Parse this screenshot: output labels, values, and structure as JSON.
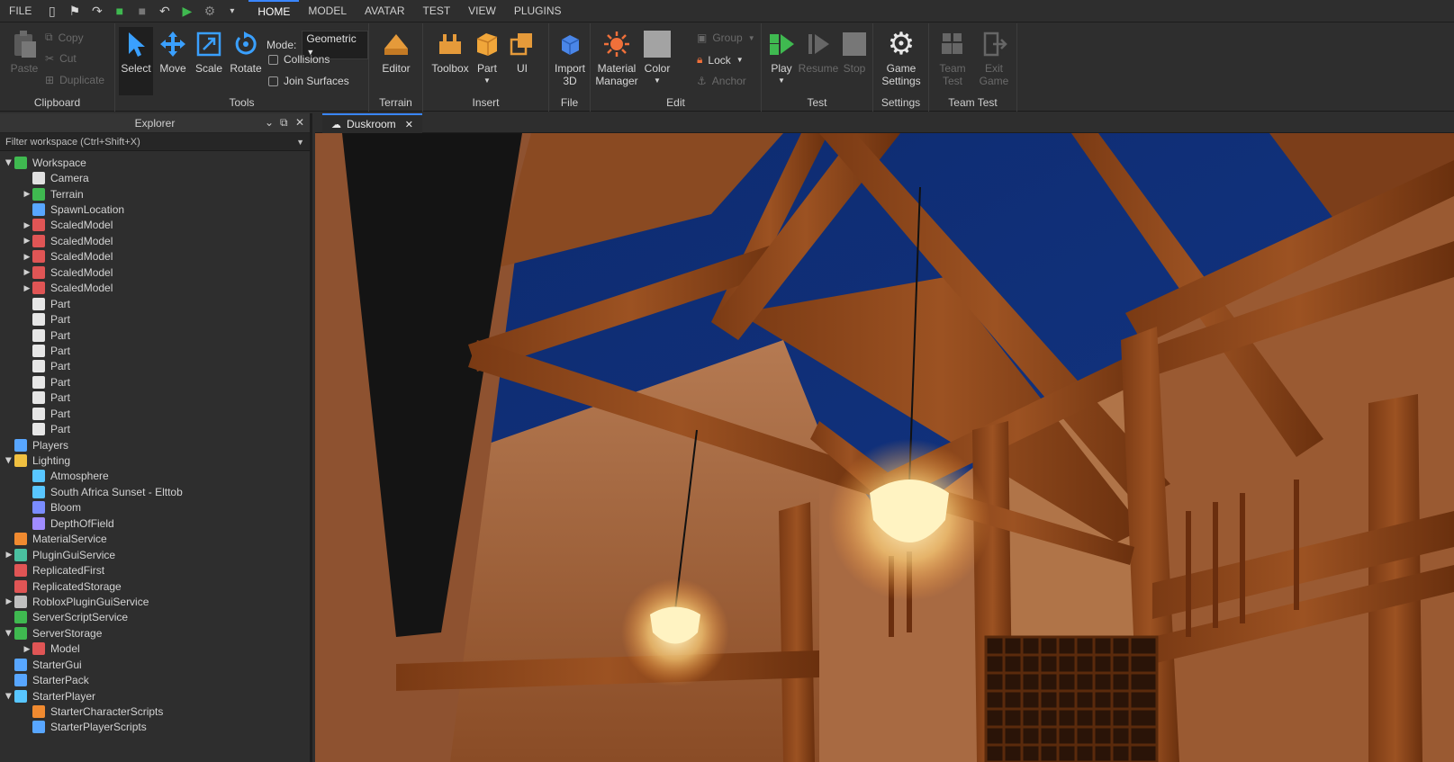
{
  "menu": {
    "file": "FILE",
    "tabs": [
      "HOME",
      "MODEL",
      "AVATAR",
      "TEST",
      "VIEW",
      "PLUGINS"
    ]
  },
  "ribbon": {
    "clipboard": {
      "label": "Clipboard",
      "paste": "Paste",
      "copy": "Copy",
      "cut": "Cut",
      "duplicate": "Duplicate"
    },
    "tools": {
      "label": "Tools",
      "select": "Select",
      "move": "Move",
      "scale": "Scale",
      "rotate": "Rotate",
      "mode_label": "Mode:",
      "mode_value": "Geometric",
      "collisions": "Collisions",
      "join_surfaces": "Join Surfaces"
    },
    "terrain": {
      "label": "Terrain",
      "editor": "Editor"
    },
    "insert": {
      "label": "Insert",
      "toolbox": "Toolbox",
      "part": "Part",
      "ui": "UI"
    },
    "file": {
      "label": "File",
      "import": "Import",
      "import2": "3D"
    },
    "edit": {
      "label": "Edit",
      "material": "Material",
      "material2": "Manager",
      "color": "Color",
      "group": "Group",
      "lock": "Lock",
      "anchor": "Anchor"
    },
    "test": {
      "label": "Test",
      "play": "Play",
      "resume": "Resume",
      "stop": "Stop"
    },
    "settings": {
      "label": "Settings",
      "game": "Game",
      "game2": "Settings"
    },
    "teamtest": {
      "label": "Team Test",
      "team": "Team",
      "team2": "Test",
      "exit": "Exit",
      "exit2": "Game"
    }
  },
  "explorer": {
    "title": "Explorer",
    "filter_placeholder": "Filter workspace (Ctrl+Shift+X)",
    "tree": [
      {
        "label": "Workspace",
        "depth": 0,
        "arrow": "open",
        "icon": "globe-icon",
        "color": "#3fb950"
      },
      {
        "label": "Camera",
        "depth": 1,
        "arrow": "",
        "icon": "camera-icon",
        "color": "#e0e0e0"
      },
      {
        "label": "Terrain",
        "depth": 1,
        "arrow": "closed",
        "icon": "terrain-icon",
        "color": "#3fb950"
      },
      {
        "label": "SpawnLocation",
        "depth": 1,
        "arrow": "",
        "icon": "spawn-icon",
        "color": "#58a6ff"
      },
      {
        "label": "ScaledModel",
        "depth": 1,
        "arrow": "closed",
        "icon": "model-icon",
        "color": "#e05555"
      },
      {
        "label": "ScaledModel",
        "depth": 1,
        "arrow": "closed",
        "icon": "model-icon",
        "color": "#e05555"
      },
      {
        "label": "ScaledModel",
        "depth": 1,
        "arrow": "closed",
        "icon": "model-icon",
        "color": "#e05555"
      },
      {
        "label": "ScaledModel",
        "depth": 1,
        "arrow": "closed",
        "icon": "model-icon",
        "color": "#e05555"
      },
      {
        "label": "ScaledModel",
        "depth": 1,
        "arrow": "closed",
        "icon": "model-icon",
        "color": "#e05555"
      },
      {
        "label": "Part",
        "depth": 1,
        "arrow": "",
        "icon": "part-icon",
        "color": "#e6e6e6"
      },
      {
        "label": "Part",
        "depth": 1,
        "arrow": "",
        "icon": "part-icon",
        "color": "#e6e6e6"
      },
      {
        "label": "Part",
        "depth": 1,
        "arrow": "",
        "icon": "part-icon",
        "color": "#e6e6e6"
      },
      {
        "label": "Part",
        "depth": 1,
        "arrow": "",
        "icon": "part-icon",
        "color": "#e6e6e6"
      },
      {
        "label": "Part",
        "depth": 1,
        "arrow": "",
        "icon": "part-icon",
        "color": "#e6e6e6"
      },
      {
        "label": "Part",
        "depth": 1,
        "arrow": "",
        "icon": "part-icon",
        "color": "#e6e6e6"
      },
      {
        "label": "Part",
        "depth": 1,
        "arrow": "",
        "icon": "part-icon",
        "color": "#e6e6e6"
      },
      {
        "label": "Part",
        "depth": 1,
        "arrow": "",
        "icon": "wedge-icon",
        "color": "#e6e6e6"
      },
      {
        "label": "Part",
        "depth": 1,
        "arrow": "",
        "icon": "wedge-icon",
        "color": "#e6e6e6"
      },
      {
        "label": "Players",
        "depth": 0,
        "arrow": "",
        "icon": "players-icon",
        "color": "#58a6ff"
      },
      {
        "label": "Lighting",
        "depth": 0,
        "arrow": "open",
        "icon": "sun-icon",
        "color": "#f0c040"
      },
      {
        "label": "Atmosphere",
        "depth": 1,
        "arrow": "",
        "icon": "atmosphere-icon",
        "color": "#58c6ff"
      },
      {
        "label": "South Africa Sunset - Elttob",
        "depth": 1,
        "arrow": "",
        "icon": "sky-icon",
        "color": "#58c6ff"
      },
      {
        "label": "Bloom",
        "depth": 1,
        "arrow": "",
        "icon": "bloom-icon",
        "color": "#7a8cff"
      },
      {
        "label": "DepthOfField",
        "depth": 1,
        "arrow": "",
        "icon": "dof-icon",
        "color": "#a08cff"
      },
      {
        "label": "MaterialService",
        "depth": 0,
        "arrow": "",
        "icon": "material-icon",
        "color": "#f08a30"
      },
      {
        "label": "PluginGuiService",
        "depth": 0,
        "arrow": "closed",
        "icon": "plugin-icon",
        "color": "#4ac0a0"
      },
      {
        "label": "ReplicatedFirst",
        "depth": 0,
        "arrow": "",
        "icon": "replicated-icon",
        "color": "#e05555"
      },
      {
        "label": "ReplicatedStorage",
        "depth": 0,
        "arrow": "",
        "icon": "replicated-icon",
        "color": "#e05555"
      },
      {
        "label": "RobloxPluginGuiService",
        "depth": 0,
        "arrow": "closed",
        "icon": "plugin-icon",
        "color": "#c0c0c0"
      },
      {
        "label": "ServerScriptService",
        "depth": 0,
        "arrow": "",
        "icon": "server-icon",
        "color": "#3fb950"
      },
      {
        "label": "ServerStorage",
        "depth": 0,
        "arrow": "open",
        "icon": "server-icon",
        "color": "#3fb950"
      },
      {
        "label": "Model",
        "depth": 1,
        "arrow": "closed",
        "icon": "model-icon",
        "color": "#e05555"
      },
      {
        "label": "StarterGui",
        "depth": 0,
        "arrow": "",
        "icon": "gui-icon",
        "color": "#58a6ff"
      },
      {
        "label": "StarterPack",
        "depth": 0,
        "arrow": "",
        "icon": "pack-icon",
        "color": "#58a6ff"
      },
      {
        "label": "StarterPlayer",
        "depth": 0,
        "arrow": "open",
        "icon": "player-icon",
        "color": "#58c6ff"
      },
      {
        "label": "StarterCharacterScripts",
        "depth": 1,
        "arrow": "",
        "icon": "character-scripts-icon",
        "color": "#f08a30"
      },
      {
        "label": "StarterPlayerScripts",
        "depth": 1,
        "arrow": "",
        "icon": "player-scripts-icon",
        "color": "#58a6ff"
      }
    ]
  },
  "doc": {
    "tab": "Duskroom"
  }
}
